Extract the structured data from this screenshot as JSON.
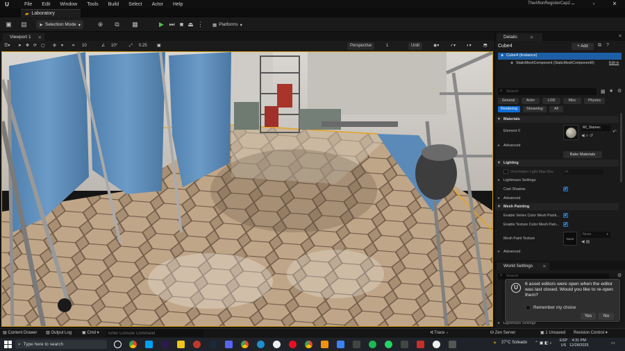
{
  "menubar": {
    "items": [
      "File",
      "Edit",
      "Window",
      "Tools",
      "Build",
      "Select",
      "Actor",
      "Help"
    ],
    "project_name": "TheAftonRegisterCap2"
  },
  "level_tab": {
    "label": "Laboratory"
  },
  "toolbar": {
    "selection_mode": "Selection Mode",
    "platforms": "Platforms"
  },
  "viewport": {
    "tab_label": "Viewport 1",
    "perspective": "Perspective",
    "lit_mode": "Unlit",
    "grid_snap": "10",
    "rot_snap": "10°",
    "scale_snap": "0.25",
    "speed": "1"
  },
  "details": {
    "tab_label": "Details",
    "actor_name": "Cube4",
    "add_label": "+ Add",
    "instance_label": "Cube4 (Instance)",
    "component_label": "StaticMeshComponent (StaticMeshComponent0)",
    "edit_link": "Edit in",
    "search_placeholder": "Search",
    "filters": [
      "General",
      "Actor",
      "LOD",
      "Misc",
      "Physics",
      "Rendering",
      "Streaming",
      "All"
    ],
    "sections": {
      "materials": "Materials",
      "element0": "Element 0",
      "material_name": "MI_Stainec",
      "advanced": "Advanced",
      "bake_materials": "Bake Materials",
      "lighting": "Lighting",
      "override_lightmap": "Overridden Light Map Res",
      "override_value": "64",
      "lightmass_settings": "Lightmass Settings",
      "cast_shadow": "Cast Shadow",
      "advanced2": "Advanced",
      "mesh_painting": "Mesh Painting",
      "enable_vertex": "Enable Vertex Color Mesh Painti...",
      "enable_texture": "Enable Texture Color Mesh Pain...",
      "mesh_paint_texture": "Mesh Paint Texture",
      "none_thumb": "None",
      "none_dropdown": "None",
      "advanced3": "Advanced"
    }
  },
  "world_settings": {
    "tab_label": "World Settings",
    "search_placeholder": "Search",
    "lightmass_settings": "Lightmass Settings"
  },
  "notification": {
    "message": "6 asset editors were open when the editor was last closed. Would you like to re-open them?",
    "remember": "Remember my choice",
    "yes": "Yes",
    "no": "No"
  },
  "bottombar": {
    "content_drawer": "Content Drawer",
    "output_log": "Output Log",
    "cmd": "Cmd",
    "cmd_placeholder": "Enter Console Command",
    "trace": "Trace",
    "zen_server": "Zen Server",
    "unsaved": "1 Unsaved",
    "revision_control": "Revision Control"
  },
  "taskbar": {
    "search_placeholder": "Type here to search",
    "weather": "27°C Soleado",
    "lang": "ESP",
    "lang2": "US",
    "time": "4:31 PM",
    "date": "12/28/2025"
  },
  "colors": {
    "accent_blue": "#0e6fd8",
    "selection_orange": "#e8a317",
    "panel_bg": "#1a1a1a"
  }
}
